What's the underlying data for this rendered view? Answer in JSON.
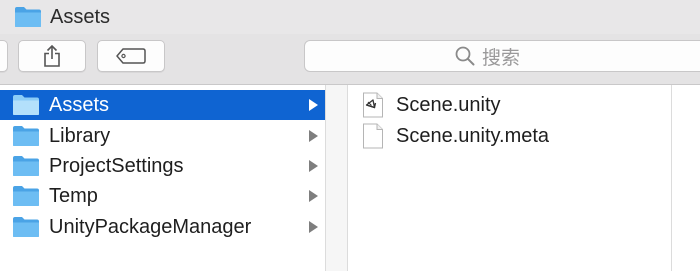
{
  "window": {
    "title": "Assets"
  },
  "toolbar": {
    "buttons": [
      {
        "name": "back-forward",
        "icon": "partial-button"
      },
      {
        "name": "share",
        "icon": "share-icon"
      },
      {
        "name": "tags",
        "icon": "tag-icon"
      }
    ],
    "search": {
      "icon": "search-icon",
      "placeholder": "搜索"
    }
  },
  "column1": {
    "items": [
      {
        "label": "Assets",
        "selected": true,
        "icon": "folder-icon"
      },
      {
        "label": "Library",
        "selected": false,
        "icon": "folder-icon"
      },
      {
        "label": "ProjectSettings",
        "selected": false,
        "icon": "folder-icon"
      },
      {
        "label": "Temp",
        "selected": false,
        "icon": "folder-icon"
      },
      {
        "label": "UnityPackageManager",
        "selected": false,
        "icon": "folder-icon"
      }
    ]
  },
  "column2": {
    "items": [
      {
        "label": "Scene.unity",
        "icon": "unity-file-icon"
      },
      {
        "label": "Scene.unity.meta",
        "icon": "document-icon"
      }
    ]
  },
  "colors": {
    "selection": "#0f64d2",
    "folder": "#5eb4f0",
    "titlebar": "#e8e7e8"
  }
}
